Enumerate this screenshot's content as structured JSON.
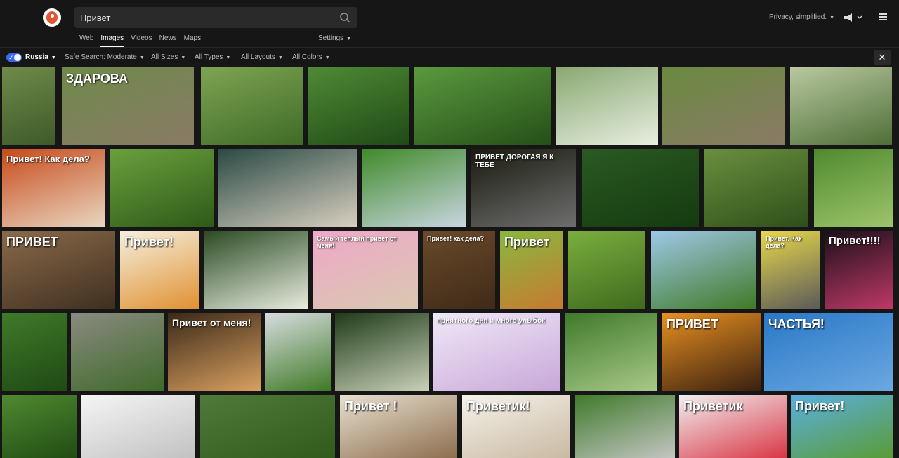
{
  "search": {
    "query": "Привет"
  },
  "tabs": [
    "Web",
    "Images",
    "Videos",
    "News",
    "Maps"
  ],
  "settings_label": "Settings",
  "privacy_label": "Privacy, simplified.",
  "filters": {
    "region": "Russia",
    "safe_search": "Safe Search: Moderate",
    "size": "All Sizes",
    "type": "All Types",
    "layout": "All Layouts",
    "color": "All Colors"
  },
  "close_label": "✕",
  "colors": {
    "accent": "#3969ef",
    "background": "#161616",
    "logo": "#de5833"
  },
  "images": [
    {
      "cap": "",
      "colors": [
        "#6f8a4a",
        "#3e5a28"
      ]
    },
    {
      "cap": "ЗДАРОВА",
      "colors": [
        "#6e8a4a",
        "#8a7a66"
      ]
    },
    {
      "cap": "",
      "colors": [
        "#7da452",
        "#3f6b26"
      ]
    },
    {
      "cap": "",
      "colors": [
        "#4f8a36",
        "#1f4a16"
      ]
    },
    {
      "cap": "",
      "colors": [
        "#5a9a3e",
        "#254f18"
      ]
    },
    {
      "cap": "",
      "colors": [
        "#8aa873",
        "#e8efe0"
      ]
    },
    {
      "cap": "",
      "colors": [
        "#6a8a40",
        "#8a7a66"
      ]
    },
    {
      "cap": "",
      "colors": [
        "#b8c8a0",
        "#4f6e36"
      ]
    },
    {
      "cap": "Привет! Как дела?",
      "colors": [
        "#c84a1a",
        "#e8d6c0"
      ]
    },
    {
      "cap": "",
      "colors": [
        "#6aa03e",
        "#2f5a18"
      ]
    },
    {
      "cap": "",
      "colors": [
        "#2a4a44",
        "#d8cfc0"
      ]
    },
    {
      "cap": "",
      "colors": [
        "#3f8a2a",
        "#c9d6e0"
      ]
    },
    {
      "cap": "ПРИВЕТ ДОРОГАЯ Я К ТЕБЕ",
      "colors": [
        "#1a1a10",
        "#6e6e6e"
      ]
    },
    {
      "cap": "",
      "colors": [
        "#2a5a22",
        "#153a10"
      ]
    },
    {
      "cap": "",
      "colors": [
        "#6a8f3e",
        "#2f4f1a"
      ]
    },
    {
      "cap": "",
      "colors": [
        "#4f8a2f",
        "#9ec46a"
      ]
    },
    {
      "cap": "ПРИВЕТ",
      "colors": [
        "#8a6a4a",
        "#3f2f20"
      ]
    },
    {
      "cap": "Привет!",
      "colors": [
        "#f5f0e0",
        "#e09030"
      ]
    },
    {
      "cap": "",
      "colors": [
        "#2a4a22",
        "#e8ece0"
      ]
    },
    {
      "cap": "Самый теплый привет от меня!",
      "colors": [
        "#f0a8c8",
        "#d8c8b0"
      ]
    },
    {
      "cap": "Привет! как дела?",
      "colors": [
        "#6a4a2a",
        "#3f2a18"
      ]
    },
    {
      "cap": "Привет",
      "colors": [
        "#88b840",
        "#c87a30"
      ]
    },
    {
      "cap": "",
      "colors": [
        "#7aae3e",
        "#3f6a1e"
      ]
    },
    {
      "cap": "",
      "colors": [
        "#9ec8e8",
        "#3f7a26"
      ]
    },
    {
      "cap": "Привет. Как дела?",
      "colors": [
        "#e8d84a",
        "#5a5a5a"
      ]
    },
    {
      "cap": "Привет!!!!",
      "colors": [
        "#1a1018",
        "#c03868"
      ]
    },
    {
      "cap": "",
      "colors": [
        "#3f7a2a",
        "#1f4a14"
      ]
    },
    {
      "cap": "",
      "colors": [
        "#8a8a80",
        "#3f6a2a"
      ]
    },
    {
      "cap": "Привет от меня!",
      "colors": [
        "#3a2818",
        "#d8a060"
      ]
    },
    {
      "cap": "",
      "colors": [
        "#d8dce0",
        "#3f7a26"
      ]
    },
    {
      "cap": "",
      "colors": [
        "#1f3a18",
        "#c8d0b8"
      ]
    },
    {
      "cap": "приятного дня и много улыбок",
      "colors": [
        "#f0e8f8",
        "#c8a8d8"
      ]
    },
    {
      "cap": "",
      "colors": [
        "#3f7a2a",
        "#a8c888"
      ]
    },
    {
      "cap": "ПРИВЕТ",
      "colors": [
        "#e89020",
        "#3a2010"
      ]
    },
    {
      "cap": "ЧАСТЬЯ!",
      "colors": [
        "#2a78c8",
        "#6aa8e0"
      ]
    },
    {
      "cap": "",
      "colors": [
        "#4f8a2f",
        "#1f4a14"
      ]
    },
    {
      "cap": "",
      "colors": [
        "#f5f5f5",
        "#c0c0c0"
      ]
    },
    {
      "cap": "",
      "colors": [
        "#4f7a3a",
        "#2f5a1a"
      ]
    },
    {
      "cap": "Привет !",
      "colors": [
        "#e8e0d0",
        "#8a6a4a"
      ]
    },
    {
      "cap": "Приветик!",
      "colors": [
        "#f5f2ea",
        "#c8b8a0"
      ]
    },
    {
      "cap": "",
      "colors": [
        "#3f7a2a",
        "#c8c8c8"
      ]
    },
    {
      "cap": "Приветик",
      "colors": [
        "#f0f0f0",
        "#d83040"
      ]
    },
    {
      "cap": "Привет!",
      "colors": [
        "#5ab0e0",
        "#5a9a30"
      ]
    }
  ]
}
